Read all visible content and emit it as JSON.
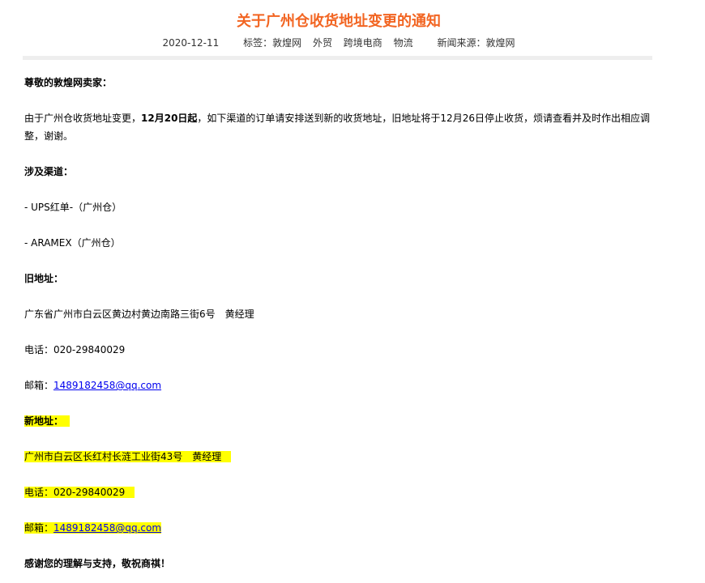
{
  "article": {
    "title": "关于广州仓收货地址变更的通知",
    "date": "2020-12-11",
    "tags_label": "标签：",
    "tags": [
      "敦煌网",
      "外贸",
      "跨境电商",
      "物流"
    ],
    "source_label": "新闻来源：",
    "source": "敦煌网"
  },
  "body": {
    "greeting": "尊敬的敦煌网卖家：",
    "intro_part1": "由于广州仓收货地址变更，",
    "intro_bold": "12月20日起",
    "intro_part2": "，如下渠道的订单请安排送到新的收货地址，旧地址将于12月26日停止收货，烦请查看并及时作出相应调整，谢谢。",
    "channels_heading": "涉及渠道：",
    "channel1": "- UPS红单-（广州仓）",
    "channel2": "- ARAMEX（广州仓）",
    "old_heading": "旧地址：",
    "old_address": "广东省广州市白云区黄边村黄边南路三街6号　黄经理",
    "old_phone": "电话：020-29840029",
    "old_email_label": "邮箱：",
    "old_email": "1489182458@qq.com",
    "new_heading": "新地址：",
    "new_address": "广州市白云区长红村长涟工业街43号　黄经理",
    "new_phone": "电话：020-29840029",
    "new_email_label": "邮箱：",
    "new_email": "1489182458@qq.com",
    "closing": "感谢您的理解与支持，敬祝商祺！"
  },
  "colors": {
    "title": "#f26522",
    "highlight": "#ffff00",
    "link": "#0000ee"
  }
}
